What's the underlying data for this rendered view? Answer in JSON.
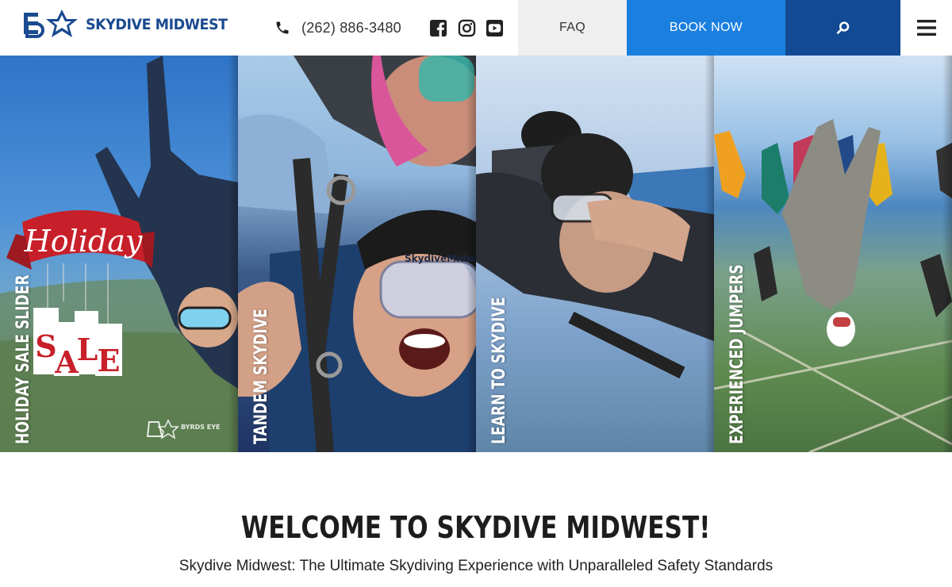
{
  "header": {
    "logo_text": "SKYDIVE MIDWEST",
    "phone": "(262) 886-3480",
    "social": [
      {
        "icon": "facebook-icon"
      },
      {
        "icon": "instagram-icon"
      },
      {
        "icon": "youtube-icon"
      }
    ],
    "nav": {
      "faq": "FAQ",
      "book": "BOOK NOW",
      "search_icon": "search-icon",
      "menu_icon": "hamburger-menu-icon"
    }
  },
  "hero": {
    "panels": [
      {
        "title": "HOLIDAY SALE SLIDER",
        "badge_word1": "Holiday",
        "badge_word2": "SALE",
        "watermark": "BYRDS EYE"
      },
      {
        "title": "TANDEM SKYDIVE",
        "goggle_text": "SkydiveMidwest.c"
      },
      {
        "title": "LEARN TO SKYDIVE"
      },
      {
        "title": "EXPERIENCED JUMPERS"
      }
    ]
  },
  "welcome": {
    "title": "WELCOME TO SKYDIVE MIDWEST!",
    "subtitle": "Skydive Midwest: The Ultimate Skydiving Experience with Unparalleled Safety Standards"
  },
  "colors": {
    "brand_blue": "#1a4a8f",
    "book_blue": "#1b7fe0",
    "search_navy": "#124a94",
    "faq_gray": "#efefef"
  }
}
